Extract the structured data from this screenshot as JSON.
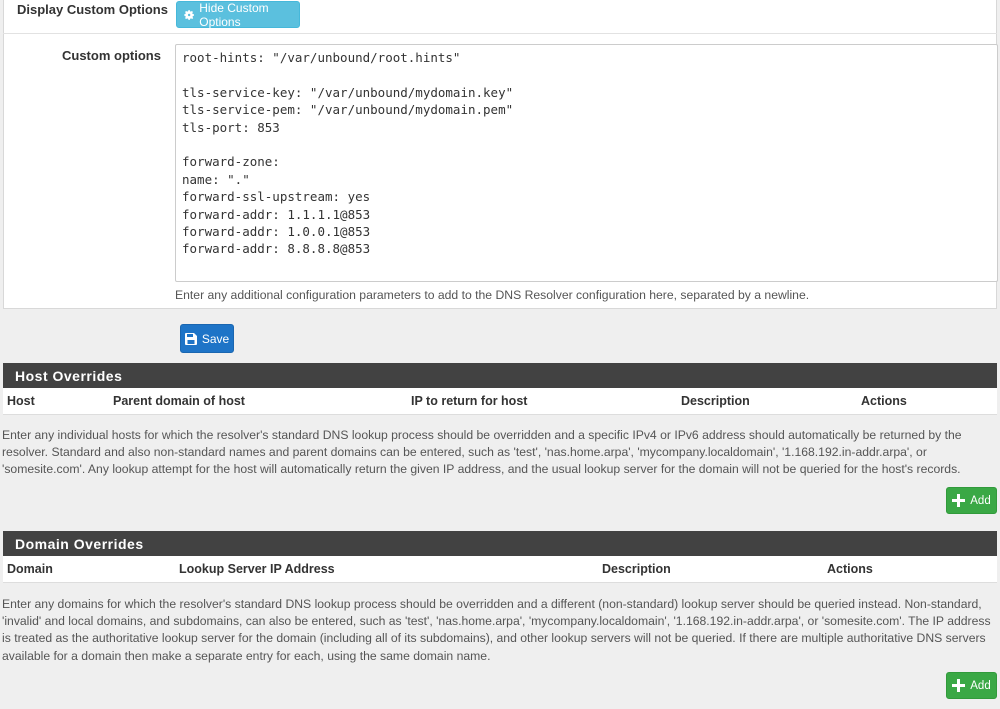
{
  "display_custom_options": {
    "label": "Display Custom Options",
    "button_label": "Hide Custom Options"
  },
  "custom_options": {
    "label": "Custom options",
    "value": "root-hints: \"/var/unbound/root.hints\"\n\ntls-service-key: \"/var/unbound/mydomain.key\"\ntls-service-pem: \"/var/unbound/mydomain.pem\"\ntls-port: 853\n\nforward-zone:\nname: \".\"\nforward-ssl-upstream: yes\nforward-addr: 1.1.1.1@853\nforward-addr: 1.0.0.1@853\nforward-addr: 8.8.8.8@853",
    "help": "Enter any additional configuration parameters to add to the DNS Resolver configuration here, separated by a newline."
  },
  "save_label": "Save",
  "host_overrides": {
    "title": "Host Overrides",
    "columns": [
      "Host",
      "Parent domain of host",
      "IP to return for host",
      "Description",
      "Actions"
    ],
    "description": "Enter any individual hosts for which the resolver's standard DNS lookup process should be overridden and a specific IPv4 or IPv6 address should automatically be returned by the resolver. Standard and also non-standard names and parent domains can be entered, such as 'test', 'nas.home.arpa', 'mycompany.localdomain', '1.168.192.in-addr.arpa', or 'somesite.com'. Any lookup attempt for the host will automatically return the given IP address, and the usual lookup server for the domain will not be queried for the host's records.",
    "add_label": "Add"
  },
  "domain_overrides": {
    "title": "Domain Overrides",
    "columns": [
      "Domain",
      "Lookup Server IP Address",
      "Description",
      "Actions"
    ],
    "description": "Enter any domains for which the resolver's standard DNS lookup process should be overridden and a different (non-standard) lookup server should be queried instead. Non-standard, 'invalid' and local domains, and subdomains, can also be entered, such as 'test', 'nas.home.arpa', 'mycompany.localdomain', '1.168.192.in-addr.arpa', or 'somesite.com'. The IP address is treated as the authoritative lookup server for the domain (including all of its subdomains), and other lookup servers will not be queried. If there are multiple authoritative DNS servers available for a domain then make a separate entry for each, using the same domain name.",
    "add_label": "Add"
  },
  "icons": {
    "hide_button": "gear-icon",
    "save_button": "floppy-disk-icon",
    "add_button": "plus-icon"
  },
  "colors": {
    "info_button": "#5bc0de",
    "primary_button": "#1e74c7",
    "success_button": "#3aa845",
    "section_header": "#424242"
  }
}
